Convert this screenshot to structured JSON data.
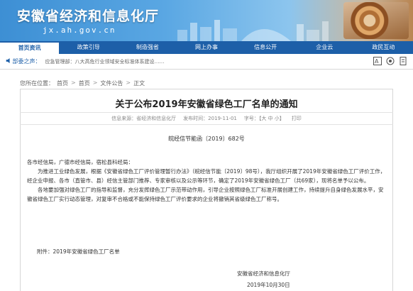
{
  "header": {
    "site_title": "安徽省经济和信息化厅",
    "domain": "jx.ah.gov.cn"
  },
  "nav": {
    "items": [
      {
        "label": "首页资讯"
      },
      {
        "label": "政策引导"
      },
      {
        "label": "制造强省"
      },
      {
        "label": "网上办事"
      },
      {
        "label": "信息公开"
      },
      {
        "label": "企业云"
      },
      {
        "label": "政民互动"
      }
    ]
  },
  "marquee": {
    "label": "部委之声：",
    "text": "应急管理部：八大高危行业领域安全标准体系建设……"
  },
  "breadcrumb": {
    "label": "您所在位置：",
    "items": [
      "首页",
      "首页",
      "文件公告",
      "正文"
    ]
  },
  "article": {
    "title": "关于公布2019年安徽省绿色工厂名单的通知",
    "meta": {
      "source": "信息来源：省经济和信息化厅",
      "date": "发布时间：2019-11-01",
      "font_size": "字号：【大 中 小】",
      "print": "打印"
    },
    "doc_number": "皖经信节能函〔2019〕682号",
    "salutation": "各市经信局，广德市经信局，宿松县科经局：",
    "paragraph1": "为推进工业绿色发展，根据《安徽省绿色工厂评价管理暂行办法》（皖经信节能〔2019〕98号），我厅组织开展了2019年安徽省绿色工厂评价工作，经企业申报、各市（直管市、县）经信主管部门推荐、专家审核以及公示等环节，确定了2019年安徽省绿色工厂（共69家），现将名单予以公布。",
    "paragraph2": "各地要加强对绿色工厂的指导和监督，充分发挥绿色工厂示范带动作用，引导企业按照绿色工厂标准开展创建工作，持续提升自身绿色发展水平，安徽省绿色工厂实行动态管理，对复审不合格或不能保持绿色工厂评价要求的企业将撤销其省级绿色工厂称号。",
    "attachment": "附件：2019年安徽省绿色工厂名单",
    "signature": "安徽省经济和信息化厅",
    "sign_date": "2019年10月30日"
  }
}
